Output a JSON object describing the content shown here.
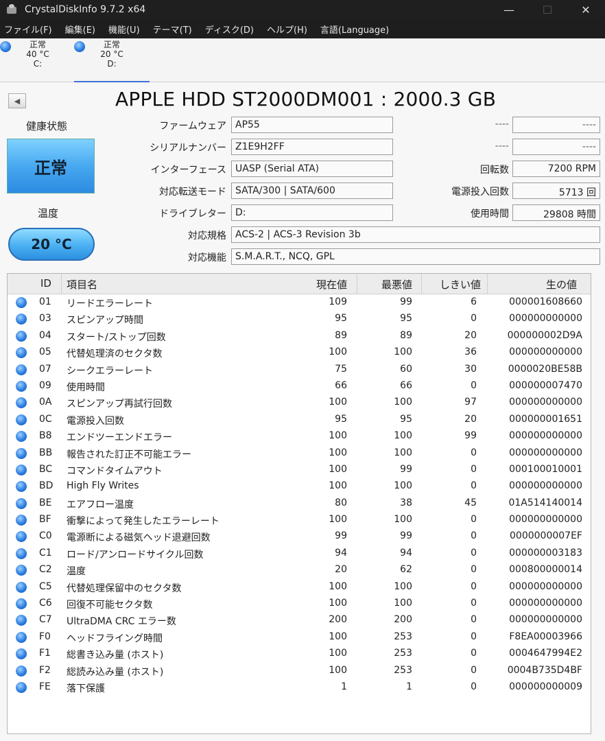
{
  "window": {
    "title": "CrystalDiskInfo 9.7.2 x64",
    "controls": {
      "minimize": "—",
      "maximize": "☐",
      "close": "✕"
    }
  },
  "menu": [
    "ファイル(F)",
    "編集(E)",
    "機能(U)",
    "テーマ(T)",
    "ディスク(D)",
    "ヘルプ(H)",
    "言語(Language)"
  ],
  "drives": [
    {
      "status": "正常",
      "temp": "40 °C",
      "letter": "C:"
    },
    {
      "status": "正常",
      "temp": "20 °C",
      "letter": "D:"
    }
  ],
  "disk": {
    "title": "APPLE HDD ST2000DM001 : 2000.3 GB",
    "health_label": "健康状態",
    "health_value": "正常",
    "temp_label": "温度",
    "temp_value": "20 °C",
    "firmware_label": "ファームウェア",
    "firmware": "AP55",
    "serial_label": "シリアルナンバー",
    "serial": "Z1E9H2FF",
    "interface_label": "インターフェース",
    "interface": "UASP (Serial ATA)",
    "transfer_label": "対応転送モード",
    "transfer": "SATA/300 | SATA/600",
    "drive_letter_label": "ドライブレター",
    "drive_letter": "D:",
    "standard_label": "対応規格",
    "standard": "ACS-2 | ACS-3 Revision 3b",
    "features_label": "対応機能",
    "features": "S.M.A.R.T., NCQ, GPL",
    "right_blank1_label": "----",
    "right_blank1": "----",
    "right_blank2_label": "----",
    "right_blank2": "----",
    "rotation_label": "回転数",
    "rotation": "7200 RPM",
    "power_count_label": "電源投入回数",
    "power_count": "5713 回",
    "power_hours_label": "使用時間",
    "power_hours": "29808 時間"
  },
  "smart": {
    "headers": {
      "id": "ID",
      "name": "項目名",
      "current": "現在値",
      "worst": "最悪値",
      "threshold": "しきい値",
      "raw": "生の値"
    },
    "rows": [
      {
        "id": "01",
        "name": "リードエラーレート",
        "current": "109",
        "worst": "99",
        "threshold": "6",
        "raw": "000001608660"
      },
      {
        "id": "03",
        "name": "スピンアップ時間",
        "current": "95",
        "worst": "95",
        "threshold": "0",
        "raw": "000000000000"
      },
      {
        "id": "04",
        "name": "スタート/ストップ回数",
        "current": "89",
        "worst": "89",
        "threshold": "20",
        "raw": "000000002D9A"
      },
      {
        "id": "05",
        "name": "代替処理済のセクタ数",
        "current": "100",
        "worst": "100",
        "threshold": "36",
        "raw": "000000000000"
      },
      {
        "id": "07",
        "name": "シークエラーレート",
        "current": "75",
        "worst": "60",
        "threshold": "30",
        "raw": "0000020BE58B"
      },
      {
        "id": "09",
        "name": "使用時間",
        "current": "66",
        "worst": "66",
        "threshold": "0",
        "raw": "000000007470"
      },
      {
        "id": "0A",
        "name": "スピンアップ再試行回数",
        "current": "100",
        "worst": "100",
        "threshold": "97",
        "raw": "000000000000"
      },
      {
        "id": "0C",
        "name": "電源投入回数",
        "current": "95",
        "worst": "95",
        "threshold": "20",
        "raw": "000000001651"
      },
      {
        "id": "B8",
        "name": "エンドツーエンドエラー",
        "current": "100",
        "worst": "100",
        "threshold": "99",
        "raw": "000000000000"
      },
      {
        "id": "BB",
        "name": "報告された訂正不可能エラー",
        "current": "100",
        "worst": "100",
        "threshold": "0",
        "raw": "000000000000"
      },
      {
        "id": "BC",
        "name": "コマンドタイムアウト",
        "current": "100",
        "worst": "99",
        "threshold": "0",
        "raw": "000100010001"
      },
      {
        "id": "BD",
        "name": "High Fly Writes",
        "current": "100",
        "worst": "100",
        "threshold": "0",
        "raw": "000000000000"
      },
      {
        "id": "BE",
        "name": "エアフロー温度",
        "current": "80",
        "worst": "38",
        "threshold": "45",
        "raw": "01A514140014"
      },
      {
        "id": "BF",
        "name": "衝撃によって発生したエラーレート",
        "current": "100",
        "worst": "100",
        "threshold": "0",
        "raw": "000000000000"
      },
      {
        "id": "C0",
        "name": "電源断による磁気ヘッド退避回数",
        "current": "99",
        "worst": "99",
        "threshold": "0",
        "raw": "0000000007EF"
      },
      {
        "id": "C1",
        "name": "ロード/アンロードサイクル回数",
        "current": "94",
        "worst": "94",
        "threshold": "0",
        "raw": "000000003183"
      },
      {
        "id": "C2",
        "name": "温度",
        "current": "20",
        "worst": "62",
        "threshold": "0",
        "raw": "000800000014"
      },
      {
        "id": "C5",
        "name": "代替処理保留中のセクタ数",
        "current": "100",
        "worst": "100",
        "threshold": "0",
        "raw": "000000000000"
      },
      {
        "id": "C6",
        "name": "回復不可能セクタ数",
        "current": "100",
        "worst": "100",
        "threshold": "0",
        "raw": "000000000000"
      },
      {
        "id": "C7",
        "name": "UltraDMA CRC エラー数",
        "current": "200",
        "worst": "200",
        "threshold": "0",
        "raw": "000000000000"
      },
      {
        "id": "F0",
        "name": "ヘッドフライング時間",
        "current": "100",
        "worst": "253",
        "threshold": "0",
        "raw": "F8EA00003966"
      },
      {
        "id": "F1",
        "name": "総書き込み量 (ホスト)",
        "current": "100",
        "worst": "253",
        "threshold": "0",
        "raw": "0004647994E2"
      },
      {
        "id": "F2",
        "name": "総読み込み量 (ホスト)",
        "current": "100",
        "worst": "253",
        "threshold": "0",
        "raw": "0004B735D4BF"
      },
      {
        "id": "FE",
        "name": "落下保護",
        "current": "1",
        "worst": "1",
        "threshold": "0",
        "raw": "000000000009"
      }
    ]
  }
}
